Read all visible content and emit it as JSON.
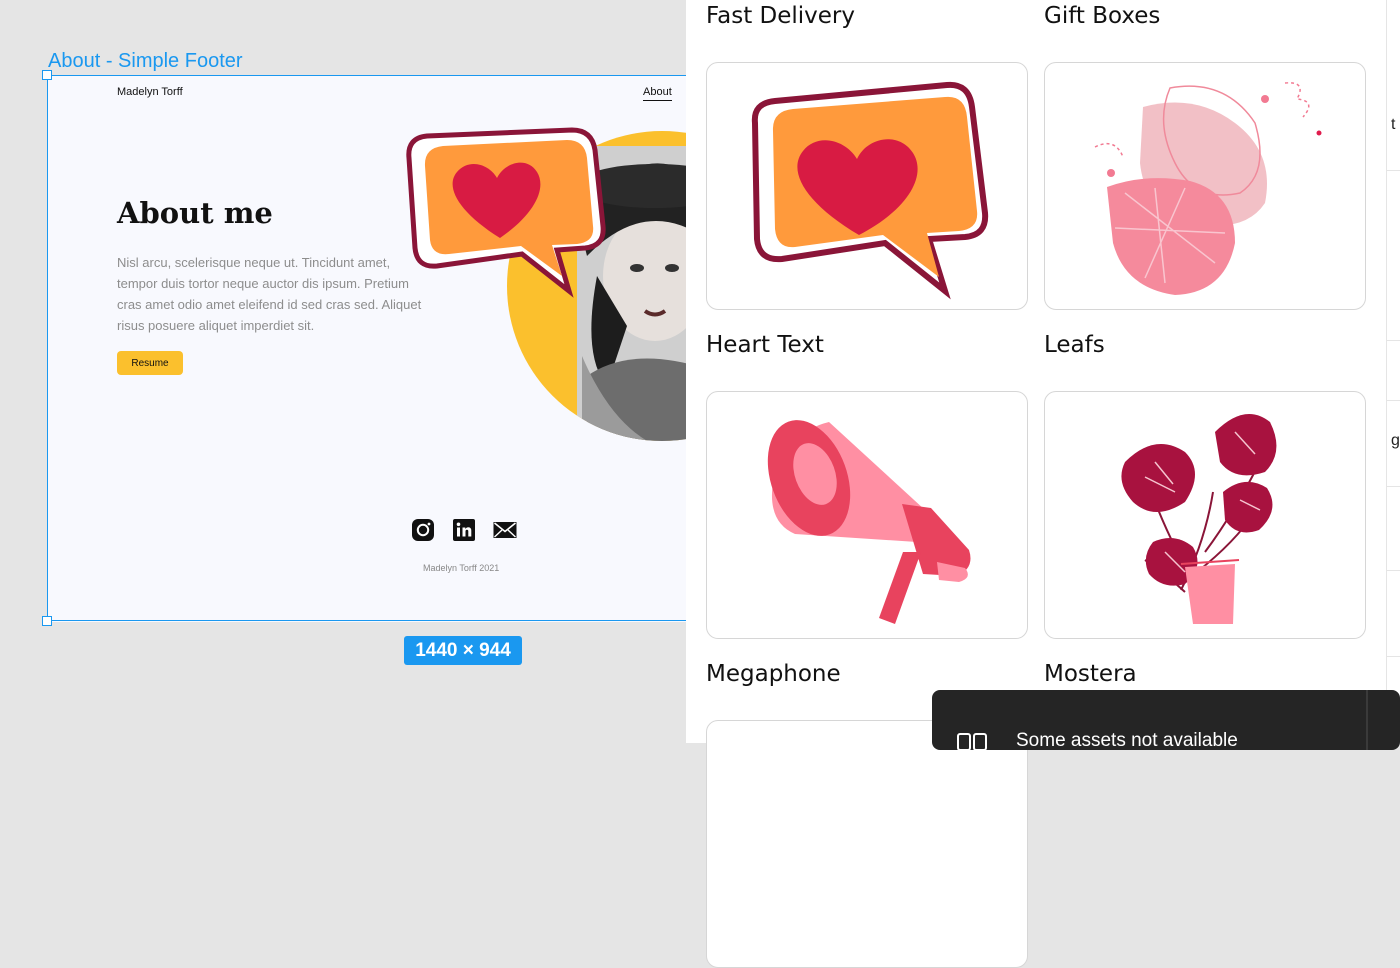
{
  "canvas": {
    "frame_label": "About - Simple Footer",
    "frame_size": "1440 × 944",
    "accent_color": "#1a98f0"
  },
  "site": {
    "name": "Madelyn Torff",
    "nav_about": "About",
    "heading": "About me",
    "body": "Nisl arcu, scelerisque neque ut. Tincidunt amet, tempor duis tortor neque auctor dis ipsum. Pretium cras amet odio amet eleifend id sed cras sed. Aliquet risus posuere aliquet imperdiet sit.",
    "resume_label": "Resume",
    "social_icons": [
      "instagram-icon",
      "linkedin-icon",
      "mail-icon"
    ],
    "copyright": "Madelyn Torff 2021",
    "button_color": "#fbc02d"
  },
  "assets": {
    "top_titles": [
      "Fast Delivery",
      "Gift Boxes"
    ],
    "items": [
      {
        "title": "Heart Text",
        "icon": "heart-speech-bubble-icon"
      },
      {
        "title": "Leafs",
        "icon": "leafs-icon"
      },
      {
        "title": "Megaphone",
        "icon": "megaphone-icon"
      },
      {
        "title": "Mostera",
        "icon": "monstera-plant-icon"
      }
    ]
  },
  "edge": {
    "fragment_1": "t",
    "fragment_2": "g"
  },
  "toast": {
    "text": "Some assets not available"
  }
}
